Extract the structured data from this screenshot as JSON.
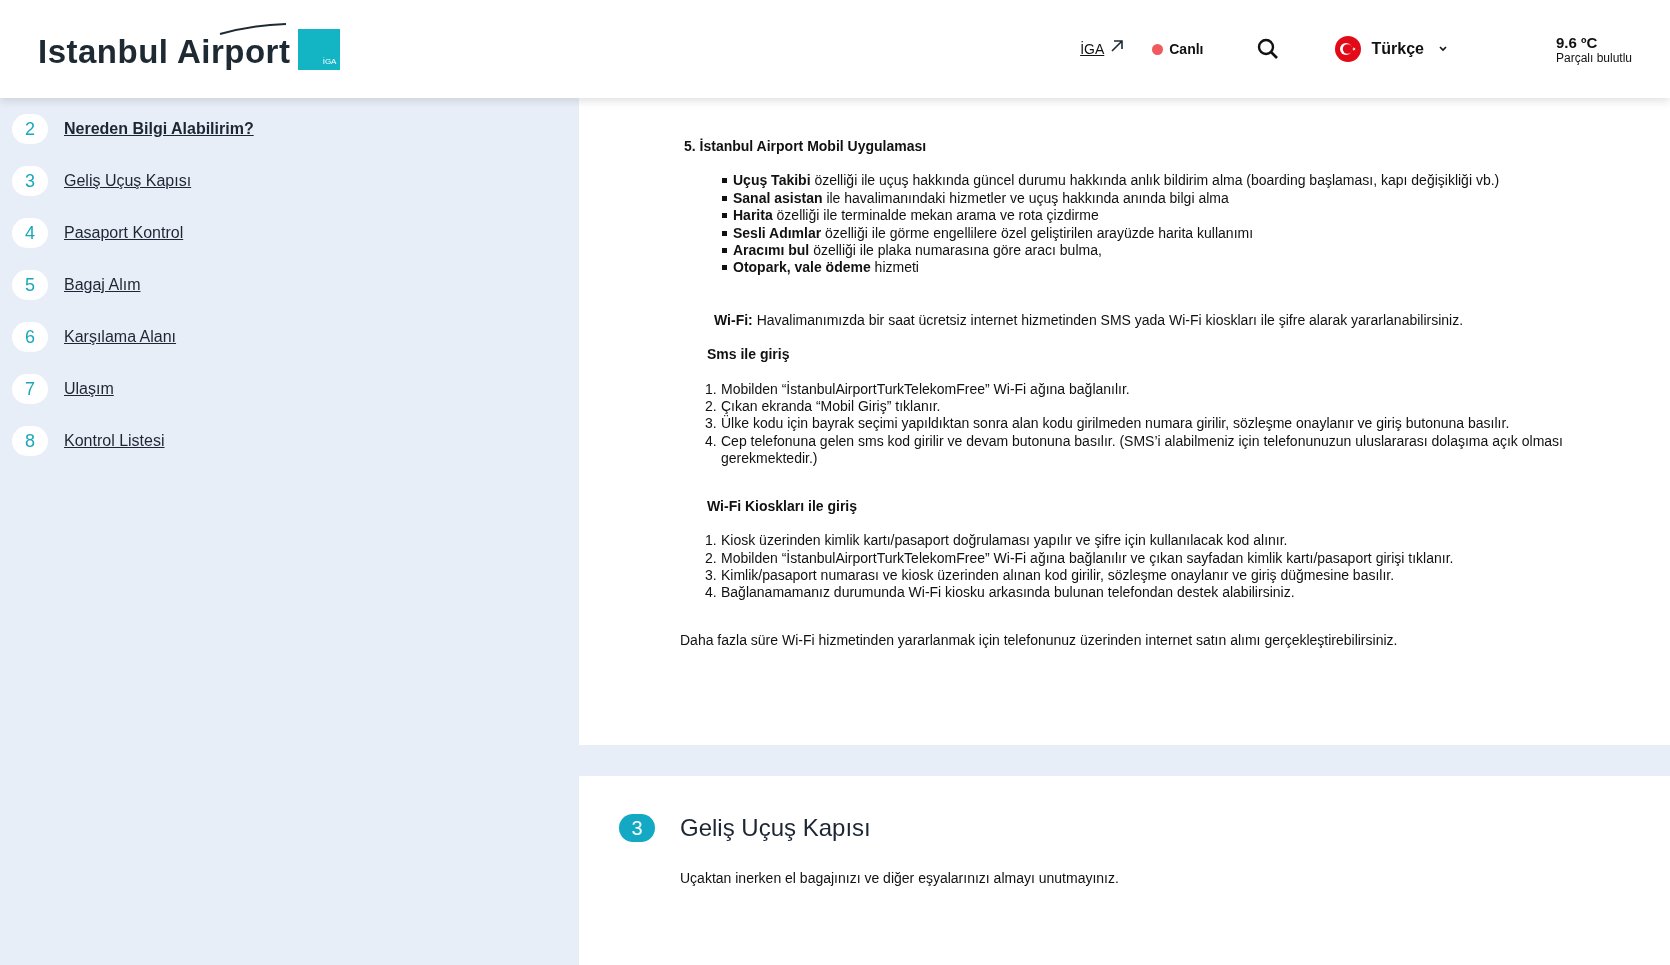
{
  "header": {
    "logo_text": "Istanbul Airport",
    "logo_badge": "İGA",
    "iga_link": "İGA",
    "live": {
      "label": "Canlı",
      "on": true
    },
    "language": "Türkçe",
    "weather": {
      "temperature": "9.6 ºC",
      "condition": "Parçalı bulutlu"
    }
  },
  "sidebar": {
    "items": [
      {
        "number": "2",
        "label": "Nereden Bilgi Alabilirim?",
        "selected": true
      },
      {
        "number": "3",
        "label": "Geliş Uçuş Kapısı",
        "selected": false
      },
      {
        "number": "4",
        "label": "Pasaport Kontrol",
        "selected": false
      },
      {
        "number": "5",
        "label": "Bagaj Alım",
        "selected": false
      },
      {
        "number": "6",
        "label": "Karşılama Alanı",
        "selected": false
      },
      {
        "number": "7",
        "label": "Ulaşım",
        "selected": false
      },
      {
        "number": "8",
        "label": "Kontrol Listesi",
        "selected": false
      }
    ]
  },
  "content": {
    "blocks": [
      {
        "kind": "heading",
        "text": "5. İstanbul Airport Mobil Uygulaması"
      },
      {
        "kind": "bullets",
        "items": [
          "**Uçuş Takibi** özelliği ile uçuş hakkında güncel durumu hakkında anlık bildirim alma (boarding başlaması, kapı değişikliği vb.)",
          "**Sanal asistan** ile havalimanındaki hizmetler ve uçuş hakkında anında bilgi alma",
          "**Harita** özelliği ile terminalde mekan arama ve rota çizdirme",
          "**Sesli Adımlar** özelliği ile görme engellilere özel geliştirilen arayüzde harita kullanımı",
          "**Aracımı bul** özelliği ile plaka numarasına göre aracı bulma,",
          "**Otopark, vale ödeme** hizmeti"
        ]
      },
      {
        "kind": "note",
        "text": "**Wi-Fi:** Havalimanımızda bir saat ücretsiz internet hizmetinden SMS yada Wi-Fi kioskları ile şifre alarak yararlanabilirsiniz."
      },
      {
        "kind": "subheading",
        "text": "Sms ile giriş"
      },
      {
        "kind": "steps",
        "items": [
          {
            "marker": "1.",
            "text": "Mobilden “İstanbulAirportTurkTelekomFree” Wi-Fi ağına bağlanılır."
          },
          {
            "marker": "2.",
            "text": "Çıkan ekranda “Mobil Giriş” tıklanır."
          },
          {
            "marker": "3.",
            "text": "Ülke kodu için bayrak seçimi yapıldıktan sonra alan kodu girilmeden numara girilir, sözleşme onaylanır ve giriş butonuna basılır."
          },
          {
            "marker": "4.",
            "text": "Cep telefonuna gelen sms kod girilir ve devam butonuna basılır. (SMS’i alabilmeniz için telefonunuzun uluslararası dolaşıma açık olması gerekmektedir.)"
          }
        ]
      },
      {
        "kind": "subheading",
        "text": "Wi-Fi Kioskları ile giriş"
      },
      {
        "kind": "steps",
        "items": [
          {
            "marker": "1.",
            "text": "Kiosk üzerinden kimlik kartı/pasaport doğrulaması yapılır ve şifre için kullanılacak kod alınır."
          },
          {
            "marker": "2.",
            "text": "Mobilden “İstanbulAirportTurkTelekomFree” Wi-Fi ağına bağlanılır ve çıkan sayfadan kimlik kartı/pasaport girişi tıklanır."
          },
          {
            "marker": "3.",
            "text": "Kimlik/pasaport numarası ve kiosk üzerinden alınan kod girilir, sözleşme onaylanır ve giriş düğmesine basılır."
          },
          {
            "marker": "4.",
            "text": "Bağlanamamanız durumunda Wi-Fi kiosku arkasında bulunan telefondan destek alabilirsiniz."
          }
        ]
      },
      {
        "kind": "para",
        "text": "Daha fazla süre Wi-Fi hizmetinden yararlanmak için telefonunuz üzerinden internet satın alımı gerçekleştirebilirsiniz."
      }
    ]
  },
  "next_section": {
    "number": "3",
    "title": "Geliş Uçuş Kapısı",
    "text": "Uçaktan inerken el bagajınızı ve diğer eşyalarınızı almayı unutmayınız."
  }
}
